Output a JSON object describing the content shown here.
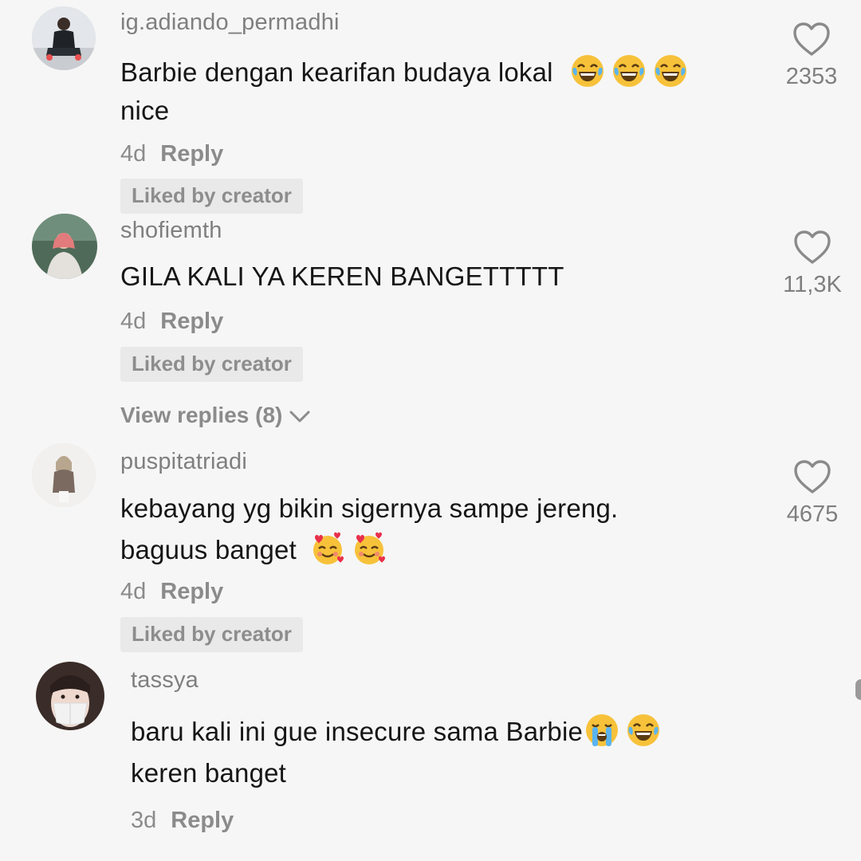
{
  "comments": [
    {
      "username": "ig.adiando_permadhi",
      "text_line1": "Barbie dengan kearifan budaya lokal",
      "text_line2": "nice",
      "time": "4d",
      "reply_label": "Reply",
      "liked_by_creator": "Liked by creator",
      "like_count": "2353",
      "emojis": [
        "laughing-tears-emoji",
        "laughing-tears-emoji",
        "laughing-tears-emoji"
      ]
    },
    {
      "username": "shofiemth",
      "text_line1": "GILA KALI YA KEREN BANGETTTTT",
      "time": "4d",
      "reply_label": "Reply",
      "liked_by_creator": "Liked by creator",
      "like_count": "11,3K",
      "view_replies": "View replies (8)"
    },
    {
      "username": "puspitatriadi",
      "text_line1": "kebayang yg bikin sigernya sampe jereng.",
      "text_line2": "baguus banget",
      "time": "4d",
      "reply_label": "Reply",
      "liked_by_creator": "Liked by creator",
      "like_count": "4675",
      "emojis": [
        "smiling-hearts-emoji",
        "smiling-hearts-emoji"
      ]
    },
    {
      "username": "tassya",
      "text_line1": "baru kali ini gue insecure sama Barbie",
      "text_line2": "keren banget",
      "time": "3d",
      "reply_label": "Reply",
      "emojis": [
        "loudly-crying-emoji",
        "laughing-tears-emoji"
      ]
    }
  ],
  "colors": {
    "background": "#f6f6f6",
    "username": "#7f7f7f",
    "text": "#161616",
    "meta": "#8b8b8b",
    "liked_badge_bg": "#e9e9e9"
  }
}
